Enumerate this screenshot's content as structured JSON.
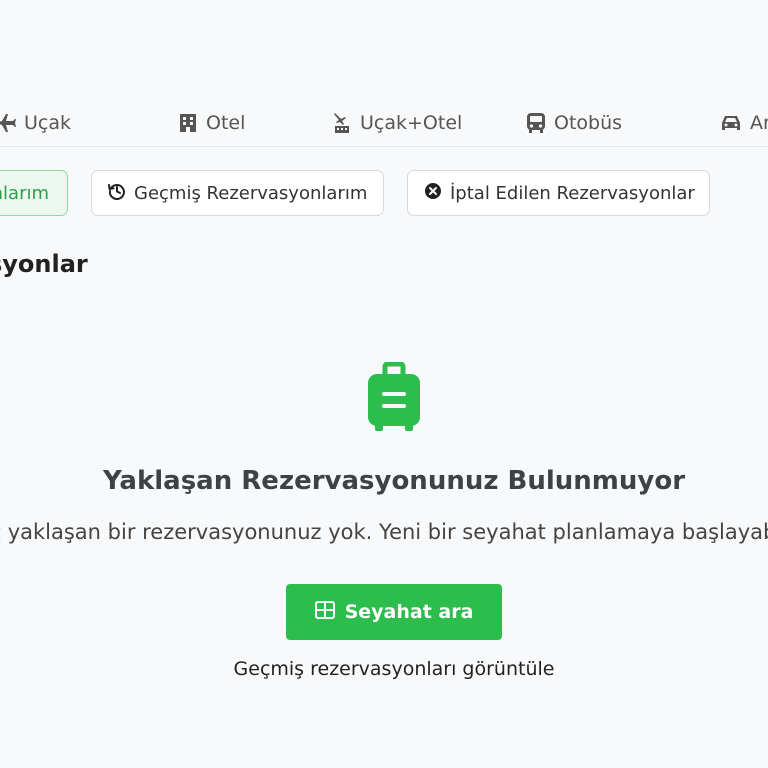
{
  "nav_tabs": [
    {
      "label": "Uçak",
      "icon": "plane-icon"
    },
    {
      "label": "Otel",
      "icon": "hotel-icon"
    },
    {
      "label": "Uçak+Otel",
      "icon": "plane-hotel-icon"
    },
    {
      "label": "Otobüs",
      "icon": "bus-icon"
    },
    {
      "label": "Ar",
      "icon": "car-icon"
    }
  ],
  "filters": {
    "active_label": "nlarım",
    "past_label": "Geçmiş Rezervasyonlarım",
    "cancelled_label": "İptal Edilen Rezervasyonlar"
  },
  "section": {
    "title": "syonlar"
  },
  "empty_state": {
    "icon": "suitcase-icon",
    "title": "Yaklaşan Rezervasyonunuz Bulunmuyor",
    "description": "z yaklaşan bir rezervasyonunuz yok. Yeni bir seyahat planlamaya başlayab",
    "search_button_label": "Seyahat ara",
    "past_link_label": "Geçmiş rezervasyonları görüntüle"
  },
  "colors": {
    "accent": "#2dbd4c",
    "accent_light": "#ecf8ef",
    "page_background": "#f8f9fa"
  }
}
